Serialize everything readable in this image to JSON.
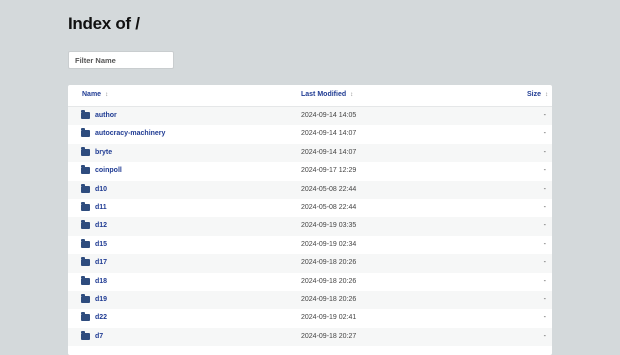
{
  "page": {
    "title": "Index of /"
  },
  "filter": {
    "placeholder": "Filter Name"
  },
  "columns": {
    "name": "Name",
    "modified": "Last Modified",
    "size": "Size",
    "sort_icon": "↕"
  },
  "rows": [
    {
      "name": "author",
      "modified": "2024-09-14 14:05",
      "size": "-"
    },
    {
      "name": "autocracy-machinery",
      "modified": "2024-09-14 14:07",
      "size": "-"
    },
    {
      "name": "bryte",
      "modified": "2024-09-14 14:07",
      "size": "-"
    },
    {
      "name": "coinpoll",
      "modified": "2024-09-17 12:29",
      "size": "-"
    },
    {
      "name": "d10",
      "modified": "2024-05-08 22:44",
      "size": "-"
    },
    {
      "name": "d11",
      "modified": "2024-05-08 22:44",
      "size": "-"
    },
    {
      "name": "d12",
      "modified": "2024-09-19 03:35",
      "size": "-"
    },
    {
      "name": "d15",
      "modified": "2024-09-19 02:34",
      "size": "-"
    },
    {
      "name": "d17",
      "modified": "2024-09-18 20:26",
      "size": "-"
    },
    {
      "name": "d18",
      "modified": "2024-09-18 20:26",
      "size": "-"
    },
    {
      "name": "d19",
      "modified": "2024-09-18 20:26",
      "size": "-"
    },
    {
      "name": "d22",
      "modified": "2024-09-19 02:41",
      "size": "-"
    },
    {
      "name": "d7",
      "modified": "2024-09-18 20:27",
      "size": "-"
    }
  ]
}
